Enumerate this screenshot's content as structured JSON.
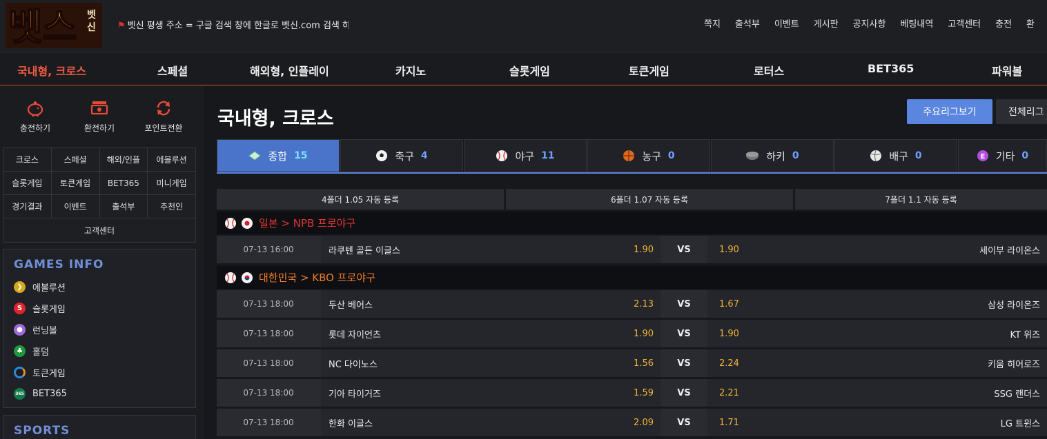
{
  "brand": {
    "logo_text": "벳스",
    "logo_sub": "벳신"
  },
  "notice": "벳신 평생 주소 = 구글 검색 창에 한글로 벳신.com 검색 하",
  "top_nav": [
    "쪽지",
    "출석부",
    "이벤트",
    "게시판",
    "공지사항",
    "베팅내역",
    "고객센터",
    "충전",
    "환"
  ],
  "main_menu": [
    "국내형, 크로스",
    "스페셜",
    "해외형, 인플레이",
    "카지노",
    "슬롯게임",
    "토큰게임",
    "로터스",
    "BET365",
    "파워볼"
  ],
  "quick_actions": [
    "충전하기",
    "환전하기",
    "포인트전환"
  ],
  "sidebar_grid": [
    [
      "크로스",
      "스페셜",
      "해외/인플",
      "에볼루션"
    ],
    [
      "슬롯게임",
      "토큰게임",
      "BET365",
      "미니게임"
    ],
    [
      "경기결과",
      "이벤트",
      "출석부",
      "추천인"
    ],
    [
      "고객센터"
    ]
  ],
  "games_info": {
    "title": "GAMES INFO",
    "items": [
      "에볼루션",
      "슬롯게임",
      "런닝볼",
      "홀덤",
      "토큰게임",
      "BET365"
    ]
  },
  "sports_title": "SPORTS",
  "page_title": "국내형, 크로스",
  "buttons": {
    "major": "주요리그보기",
    "all": "전체리그"
  },
  "sport_tabs": [
    {
      "label": "종합",
      "count": "15"
    },
    {
      "label": "축구",
      "count": "4"
    },
    {
      "label": "야구",
      "count": "11"
    },
    {
      "label": "농구",
      "count": "0"
    },
    {
      "label": "하키",
      "count": "0"
    },
    {
      "label": "배구",
      "count": "0"
    },
    {
      "label": "기타",
      "count": "0"
    }
  ],
  "bonuses": [
    "4폴더 1.05 자동 등록",
    "6폴더 1.07 자동 등록",
    "7폴더 1.1 자동 등록"
  ],
  "leagues": [
    {
      "title": "일본 > NPB 프로야구",
      "color": "#e03434",
      "matches": [
        {
          "time": "07-13 16:00",
          "home": "라쿠텐 골든 이글스",
          "home_odds": "1.90",
          "vs": "VS",
          "away_odds": "1.90",
          "away": "세이부 라이온스"
        }
      ]
    },
    {
      "title": "대한민국 > KBO 프로야구",
      "color": "#ef7c2c",
      "matches": [
        {
          "time": "07-13 18:00",
          "home": "두산 베어스",
          "home_odds": "2.13",
          "vs": "VS",
          "away_odds": "1.67",
          "away": "삼성 라이온즈"
        },
        {
          "time": "07-13 18:00",
          "home": "롯데 자이언츠",
          "home_odds": "1.90",
          "vs": "VS",
          "away_odds": "1.90",
          "away": "KT 위즈"
        },
        {
          "time": "07-13 18:00",
          "home": "NC 다이노스",
          "home_odds": "1.56",
          "vs": "VS",
          "away_odds": "2.24",
          "away": "키움 히어로즈"
        },
        {
          "time": "07-13 18:00",
          "home": "기아 타이거즈",
          "home_odds": "1.59",
          "vs": "VS",
          "away_odds": "2.21",
          "away": "SSG 랜더스"
        },
        {
          "time": "07-13 18:00",
          "home": "한화 이글스",
          "home_odds": "2.09",
          "vs": "VS",
          "away_odds": "1.71",
          "away": "LG 트윈스"
        }
      ]
    }
  ]
}
